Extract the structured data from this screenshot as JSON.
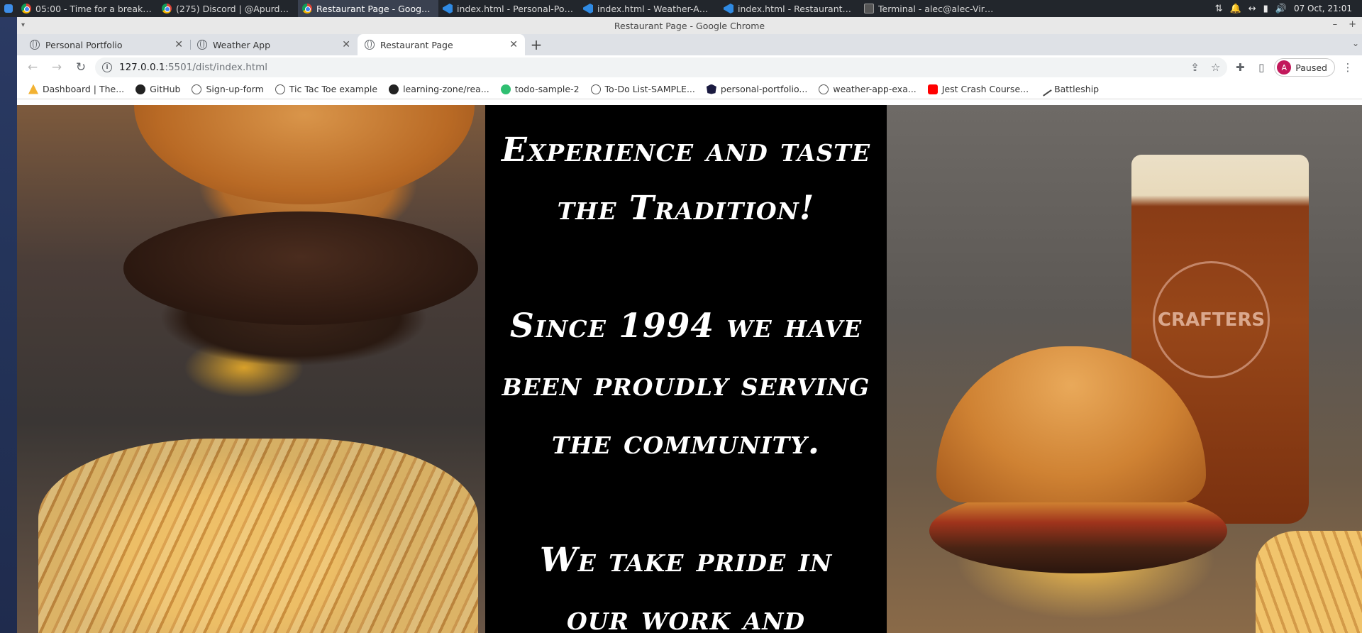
{
  "taskbar": {
    "tasks": [
      {
        "label": "05:00 - Time for a break! - G...",
        "icon": "chrome-icon",
        "active": false
      },
      {
        "label": "(275) Discord | @Apurdess ...",
        "icon": "chrome-icon",
        "active": false
      },
      {
        "label": "Restaurant Page - Google C...",
        "icon": "chrome-icon",
        "active": true
      },
      {
        "label": "index.html - Personal-Portfol...",
        "icon": "vscode-icon",
        "active": false
      },
      {
        "label": "index.html - Weather-App-A ...",
        "icon": "vscode-icon",
        "active": false
      },
      {
        "label": "index.html - Restaurant-pag...",
        "icon": "vscode-icon",
        "active": false
      },
      {
        "label": "Terminal - alec@alec-Virtual...",
        "icon": "terminal-icon",
        "active": false
      }
    ],
    "clock": "07 Oct, 21:01"
  },
  "window": {
    "title": "Restaurant Page - Google Chrome"
  },
  "tabs": [
    {
      "label": "Personal Portfolio",
      "active": false
    },
    {
      "label": "Weather App",
      "active": false
    },
    {
      "label": "Restaurant Page",
      "active": true
    }
  ],
  "omnibox": {
    "url_host": "127.0.0.1",
    "url_rest": ":5501/dist/index.html"
  },
  "profile": {
    "initial": "A",
    "status": "Paused",
    "color": "#c2185b"
  },
  "bookmarks": [
    {
      "label": "Dashboard | The...",
      "icon": "dashboard-icon"
    },
    {
      "label": "GitHub",
      "icon": "github-icon"
    },
    {
      "label": "Sign-up-form",
      "icon": "globe-icon"
    },
    {
      "label": "Tic Tac Toe example",
      "icon": "globe-icon"
    },
    {
      "label": "learning-zone/rea...",
      "icon": "github-icon"
    },
    {
      "label": "todo-sample-2",
      "icon": "check-icon"
    },
    {
      "label": "To-Do List-SAMPLE...",
      "icon": "globe-icon"
    },
    {
      "label": "personal-portfolio...",
      "icon": "angular-icon"
    },
    {
      "label": "weather-app-exa...",
      "icon": "globe-icon"
    },
    {
      "label": "Jest Crash Course...",
      "icon": "youtube-icon"
    },
    {
      "label": "Battleship",
      "icon": "battleship-icon"
    }
  ],
  "page": {
    "headline_1": "Experience and taste\nthe Tradition!",
    "headline_2": "Since 1994 we have\nbeen proudly serving\nthe community.",
    "headline_3": "We take pride in\nour work and",
    "beer_glass_logo": "CRAFTERS"
  }
}
